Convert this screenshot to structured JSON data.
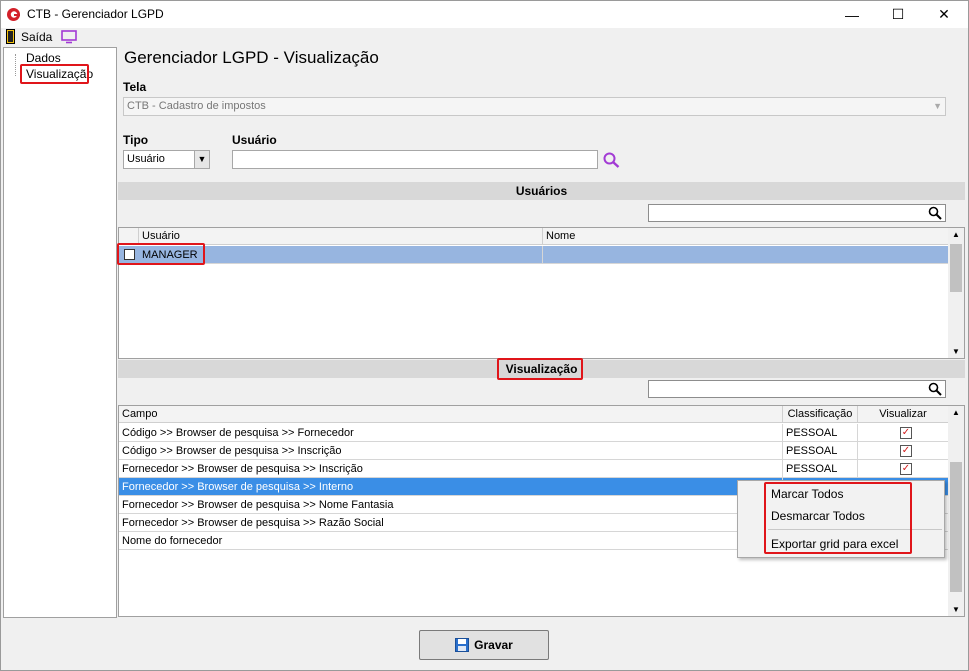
{
  "window": {
    "title": "CTB - Gerenciador LGPD",
    "controls": {
      "minimize": "—",
      "maximize": "☐",
      "close": "✕"
    }
  },
  "menu": {
    "exit_label": "Saída"
  },
  "tree": {
    "items": [
      "Dados",
      "Visualização"
    ]
  },
  "page": {
    "title": "Gerenciador LGPD - Visualização"
  },
  "form": {
    "tela_label": "Tela",
    "tela_value": "CTB - Cadastro de impostos",
    "tipo_label": "Tipo",
    "tipo_value": "Usuário",
    "usuario_label": "Usuário",
    "usuario_value": ""
  },
  "users_section": {
    "title": "Usuários",
    "columns": [
      "Usuário",
      "Nome"
    ],
    "rows": [
      {
        "usuario": "MANAGER",
        "nome": ""
      }
    ]
  },
  "view_section": {
    "title": "Visualização",
    "columns": [
      "Campo",
      "Classificação",
      "Visualizar"
    ],
    "rows": [
      {
        "campo": "Código >> Browser de pesquisa >> Fornecedor",
        "classificacao": "PESSOAL",
        "visualizar": true
      },
      {
        "campo": "Código >> Browser de pesquisa >> Inscrição",
        "classificacao": "PESSOAL",
        "visualizar": true
      },
      {
        "campo": "Fornecedor >> Browser de pesquisa >> Inscrição",
        "classificacao": "PESSOAL",
        "visualizar": true
      },
      {
        "campo": "Fornecedor >> Browser de pesquisa >> Interno",
        "classificacao": "",
        "visualizar": false
      },
      {
        "campo": "Fornecedor >> Browser de pesquisa >> Nome Fantasia",
        "classificacao": "",
        "visualizar": false
      },
      {
        "campo": "Fornecedor >> Browser de pesquisa >> Razão Social",
        "classificacao": "",
        "visualizar": false
      },
      {
        "campo": "Nome do fornecedor",
        "classificacao": "",
        "visualizar": false
      }
    ]
  },
  "context_menu": {
    "items": [
      "Marcar Todos",
      "Desmarcar Todos",
      "Exportar grid para excel"
    ]
  },
  "footer": {
    "save_label": "Gravar"
  },
  "colors": {
    "highlight": "#e0151a",
    "selection": "#3a8ee6",
    "icon_purple": "#a23ad4"
  }
}
